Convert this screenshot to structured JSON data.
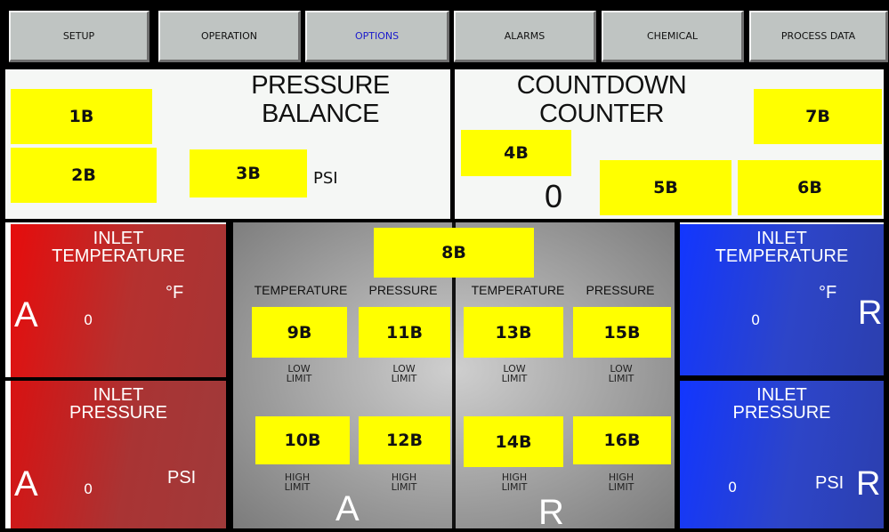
{
  "nav": [
    {
      "label": "SETUP",
      "active": false
    },
    {
      "label": "OPERATION",
      "active": false
    },
    {
      "label": "OPTIONS",
      "active": true
    },
    {
      "label": "ALARMS",
      "active": false
    },
    {
      "label": "CHEMICAL",
      "active": false
    },
    {
      "label": "PROCESS DATA",
      "active": false
    }
  ],
  "pressure_balance": {
    "title_line1": "PRESSURE",
    "title_line2": "BALANCE",
    "box_1b": "1B",
    "box_2b": "2B",
    "box_3b": "3B",
    "unit": "PSI"
  },
  "countdown": {
    "title_line1": "COUNTDOWN",
    "title_line2": "COUNTER",
    "box_4b": "4B",
    "box_5b": "5B",
    "box_6b": "6B",
    "box_7b": "7B",
    "value": "0"
  },
  "left_temp": {
    "title_line1": "INLET",
    "title_line2": "TEMPERATURE",
    "letter": "A",
    "value": "0",
    "unit": "°F"
  },
  "left_press": {
    "title_line1": "INLET",
    "title_line2": "PRESSURE",
    "letter": "A",
    "value": "0",
    "unit": "PSI"
  },
  "right_temp": {
    "title_line1": "INLET",
    "title_line2": "TEMPERATURE",
    "letter": "R",
    "value": "0",
    "unit": "°F"
  },
  "right_press": {
    "title_line1": "INLET",
    "title_line2": "PRESSURE",
    "letter": "R",
    "value": "0",
    "unit": "PSI"
  },
  "center": {
    "box_8b": "8B",
    "head_temp": "TEMPERATURE",
    "head_press": "PRESSURE",
    "low_line1": "LOW",
    "low_line2": "LIMIT",
    "high_line1": "HIGH",
    "high_line2": "LIMIT",
    "letter_a": "A",
    "letter_r": "R",
    "box_9b": "9B",
    "box_10b": "10B",
    "box_11b": "11B",
    "box_12b": "12B",
    "box_13b": "13B",
    "box_14b": "14B",
    "box_15b": "15B",
    "box_16b": "16B"
  },
  "colors": {
    "highlight": "#ffff00",
    "red": "#b5312f",
    "blue": "#2d45c8",
    "active_tab": "#1a1acc"
  }
}
